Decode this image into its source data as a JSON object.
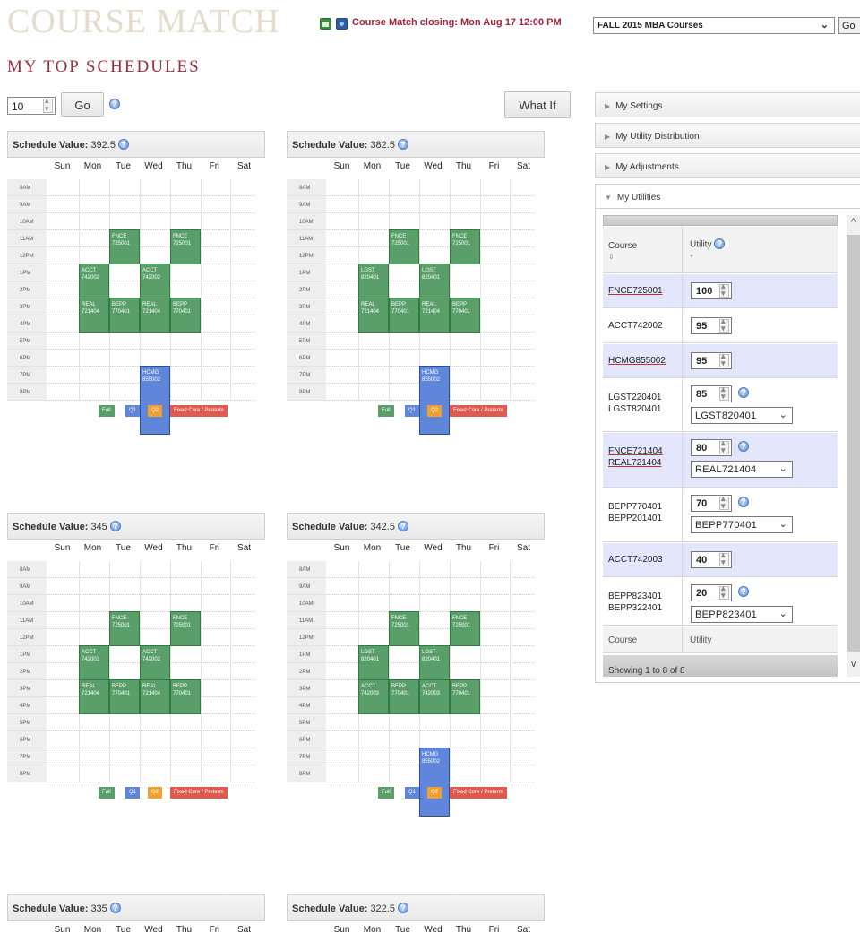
{
  "header": {
    "logo": "COURSE MATCH",
    "closing": "Course Match closing: Mon Aug 17 12:00 PM",
    "term_select": "FALL 2015 MBA Courses",
    "go_label": "Go"
  },
  "page": {
    "title": "MY TOP SCHEDULES"
  },
  "controls": {
    "count_value": "10",
    "go_label": "Go",
    "what_if_label": "What If"
  },
  "calendar": {
    "days": [
      "Sun",
      "Mon",
      "Tue",
      "Wed",
      "Thu",
      "Fri",
      "Sat"
    ],
    "hours": [
      "8AM",
      "9AM",
      "10AM",
      "11AM",
      "12PM",
      "1PM",
      "2PM",
      "3PM",
      "4PM",
      "5PM",
      "6PM",
      "7PM",
      "8PM"
    ],
    "legend": [
      "Full",
      "Q1",
      "Q2",
      "Fixed Core / Preterm"
    ]
  },
  "schedules": [
    {
      "label": "Schedule Value:",
      "value": "392.5",
      "blocks": [
        {
          "line1": "FNCE",
          "line2": "725001"
        },
        {
          "line1": "FNCE",
          "line2": "725001"
        },
        {
          "line1": "ACCT",
          "line2": "742002"
        },
        {
          "line1": "ACCT",
          "line2": "742002"
        },
        {
          "line1": "REAL",
          "line2": "721404"
        },
        {
          "line1": "BEPP",
          "line2": "770401"
        },
        {
          "line1": "REAL",
          "line2": "721404"
        },
        {
          "line1": "BEPP",
          "line2": "770401"
        },
        {
          "line1": "HCMG",
          "line2": "855002"
        }
      ]
    },
    {
      "label": "Schedule Value:",
      "value": "382.5",
      "blocks": [
        {
          "line1": "FNCE",
          "line2": "725001"
        },
        {
          "line1": "FNCE",
          "line2": "725001"
        },
        {
          "line1": "LGST",
          "line2": "820401"
        },
        {
          "line1": "LGST",
          "line2": "820401"
        },
        {
          "line1": "REAL",
          "line2": "721404"
        },
        {
          "line1": "BEPP",
          "line2": "770401"
        },
        {
          "line1": "REAL",
          "line2": "721404"
        },
        {
          "line1": "BEPP",
          "line2": "770401"
        },
        {
          "line1": "HCMG",
          "line2": "855002"
        }
      ]
    },
    {
      "label": "Schedule Value:",
      "value": "345",
      "blocks": [
        {
          "line1": "FNCE",
          "line2": "725001"
        },
        {
          "line1": "FNCE",
          "line2": "725001"
        },
        {
          "line1": "ACCT",
          "line2": "742002"
        },
        {
          "line1": "ACCT",
          "line2": "742002"
        },
        {
          "line1": "REAL",
          "line2": "721404"
        },
        {
          "line1": "BEPP",
          "line2": "770401"
        },
        {
          "line1": "REAL",
          "line2": "721404"
        },
        {
          "line1": "BEPP",
          "line2": "770401"
        }
      ]
    },
    {
      "label": "Schedule Value:",
      "value": "342.5",
      "blocks": [
        {
          "line1": "FNCE",
          "line2": "725001"
        },
        {
          "line1": "FNCE",
          "line2": "725001"
        },
        {
          "line1": "LGST",
          "line2": "820401"
        },
        {
          "line1": "LGST",
          "line2": "820401"
        },
        {
          "line1": "ACCT",
          "line2": "742003"
        },
        {
          "line1": "BEPP",
          "line2": "770401"
        },
        {
          "line1": "ACCT",
          "line2": "742003"
        },
        {
          "line1": "BEPP",
          "line2": "770401"
        },
        {
          "line1": "HCMG",
          "line2": "855002"
        }
      ]
    },
    {
      "label": "Schedule Value:",
      "value": "335",
      "blocks": []
    },
    {
      "label": "Schedule Value:",
      "value": "322.5",
      "blocks": []
    }
  ],
  "sidebar": {
    "sections": [
      "My Settings",
      "My Utility Distribution",
      "My Adjustments",
      "My Utilities"
    ],
    "table": {
      "col_course": "Course",
      "col_utility": "Utility",
      "sort_course": "⇕",
      "sort_utility": "▾",
      "rows": [
        {
          "course1": "FNCE725001",
          "course2": "",
          "utility": "100",
          "select": ""
        },
        {
          "course1": "ACCT742002",
          "course2": "",
          "utility": "95",
          "select": ""
        },
        {
          "course1": "HCMG855002",
          "course2": "",
          "utility": "95",
          "select": ""
        },
        {
          "course1": "LGST220401",
          "course2": "LGST820401",
          "utility": "85",
          "select": "LGST820401"
        },
        {
          "course1": "FNCE721404",
          "course2": "REAL721404",
          "utility": "80",
          "select": "REAL721404"
        },
        {
          "course1": "BEPP770401",
          "course2": "BEPP201401",
          "utility": "70",
          "select": "BEPP770401"
        },
        {
          "course1": "ACCT742003",
          "course2": "",
          "utility": "40",
          "select": ""
        },
        {
          "course1": "BEPP823401",
          "course2": "BEPP322401",
          "utility": "20",
          "select": "BEPP823401"
        }
      ],
      "footer_course": "Course",
      "footer_utility": "Utility",
      "showing": "Showing 1 to 8 of 8"
    }
  },
  "colors": {
    "brand_red": "#9c2d3f",
    "full_green": "#5a9e6a",
    "q1_blue": "#5f86d8",
    "q2_orange": "#f0a030",
    "fixed_red": "#e05a50",
    "row_alt": "#e4e6fb"
  }
}
